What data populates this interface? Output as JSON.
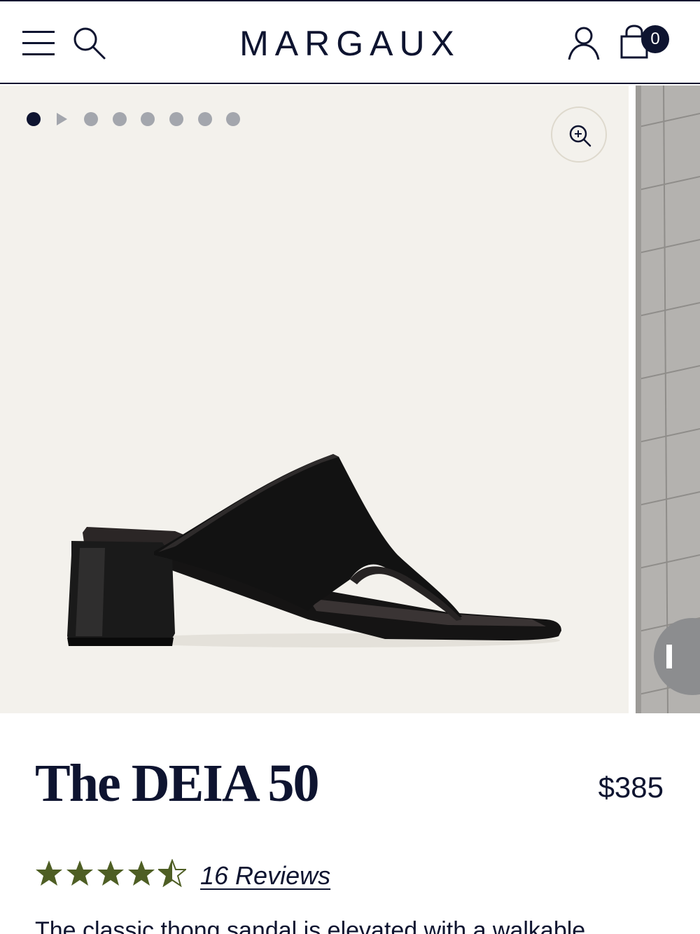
{
  "header": {
    "brand": "MARGAUX",
    "bag_count": "0",
    "icons": {
      "menu": "menu-icon",
      "search": "search-icon",
      "account": "user-icon",
      "bag": "shopping-bag-icon"
    }
  },
  "gallery": {
    "slide_count": 8,
    "active_index": 0,
    "video_slide_index": 1,
    "zoom_icon": "zoom-in-icon",
    "pause_icon": "pause-icon"
  },
  "product": {
    "name": "The DEIA 50",
    "price": "$385",
    "rating": 4.5,
    "rating_max": 5,
    "reviews_label": "16 Reviews",
    "description": "The classic thong sandal is elevated with a walkable"
  },
  "colors": {
    "navy": "#0e1430",
    "image_background": "#f3f1ec",
    "star_green": "#4e5e24",
    "dot_inactive": "#a3a6ad"
  }
}
